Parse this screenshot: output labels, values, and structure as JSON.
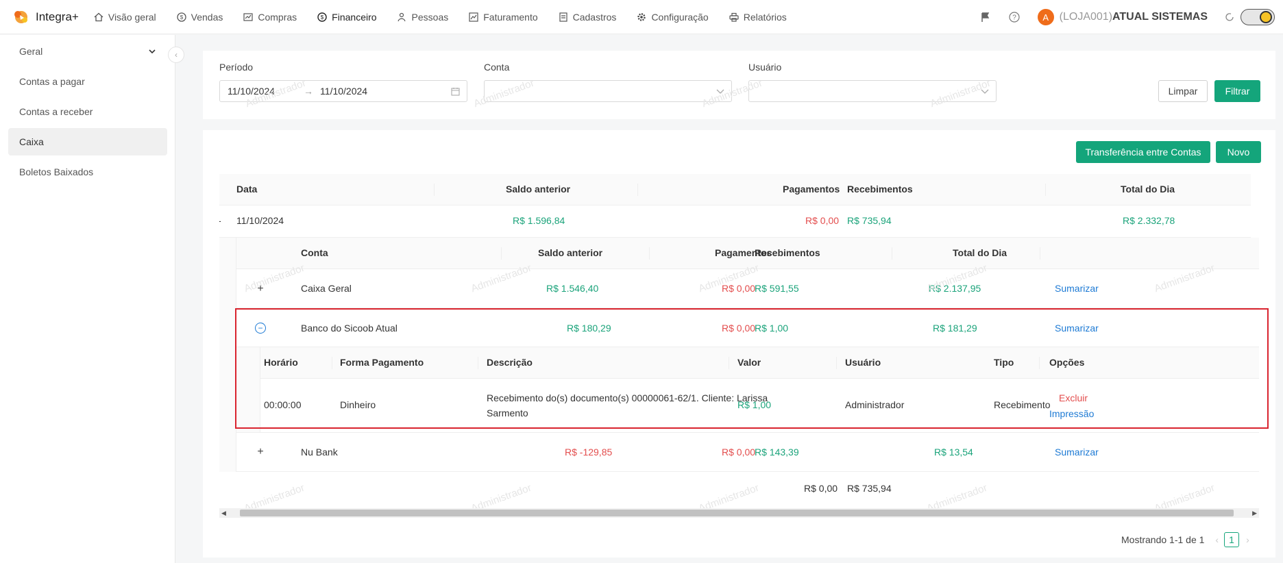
{
  "app": {
    "brand": "Integra+"
  },
  "nav": [
    {
      "label": "Visão geral",
      "icon": "home-icon"
    },
    {
      "label": "Vendas",
      "icon": "dollar-circle-icon"
    },
    {
      "label": "Compras",
      "icon": "chart-icon"
    },
    {
      "label": "Financeiro",
      "icon": "dollar-circle-icon"
    },
    {
      "label": "Pessoas",
      "icon": "people-icon"
    },
    {
      "label": "Faturamento",
      "icon": "trend-icon"
    },
    {
      "label": "Cadastros",
      "icon": "document-icon"
    },
    {
      "label": "Configuração",
      "icon": "gear-icon"
    },
    {
      "label": "Relatórios",
      "icon": "printer-icon"
    }
  ],
  "header": {
    "avatar_letter": "A",
    "store_code": "(LOJA001)",
    "store_name": "ATUAL SISTEMAS"
  },
  "sidebar": {
    "items": [
      {
        "label": "Geral"
      },
      {
        "label": "Contas a pagar"
      },
      {
        "label": "Contas a receber"
      },
      {
        "label": "Caixa"
      },
      {
        "label": "Boletos Baixados"
      }
    ]
  },
  "filters": {
    "periodo_label": "Período",
    "date_start": "11/10/2024",
    "date_end": "11/10/2024",
    "conta_label": "Conta",
    "usuario_label": "Usuário",
    "limpar": "Limpar",
    "filtrar": "Filtrar"
  },
  "actions": {
    "transfer": "Transferência entre Contas",
    "novo": "Novo"
  },
  "table": {
    "headers": {
      "data": "Data",
      "saldo": "Saldo anterior",
      "pagamentos": "Pagamentos",
      "recebimentos": "Recebimentos",
      "total": "Total do Dia"
    },
    "day": {
      "date": "11/10/2024",
      "saldo": "R$ 1.596,84",
      "pagamentos": "R$ 0,00",
      "recebimentos": "R$ 735,94",
      "total": "R$ 2.332,78"
    },
    "acc_headers": {
      "conta": "Conta",
      "saldo": "Saldo anterior",
      "pagamentos": "Pagamentos",
      "recebimentos": "Recebimentos",
      "total": "Total do Dia"
    },
    "accounts": [
      {
        "name": "Caixa Geral",
        "saldo": "R$ 1.546,40",
        "pagamentos": "R$ 0,00",
        "recebimentos": "R$ 591,55",
        "total": "R$ 2.137,95",
        "action": "Sumarizar"
      },
      {
        "name": "Banco do Sicoob Atual",
        "saldo": "R$ 180,29",
        "pagamentos": "R$ 0,00",
        "recebimentos": "R$ 1,00",
        "total": "R$ 181,29",
        "action": "Sumarizar"
      },
      {
        "name": "Nu Bank",
        "saldo": "R$ -129,85",
        "pagamentos": "R$ 0,00",
        "recebimentos": "R$ 143,39",
        "total": "R$ 13,54",
        "action": "Sumarizar"
      }
    ],
    "detail_headers": {
      "horario": "Horário",
      "forma": "Forma Pagamento",
      "descricao": "Descrição",
      "valor": "Valor",
      "usuario": "Usuário",
      "tipo": "Tipo",
      "opcoes": "Opções"
    },
    "detail": {
      "horario": "00:00:00",
      "forma": "Dinheiro",
      "descricao_l1": "Recebimento do(s) documento(s) 00000061-62/1. Cliente: Larissa",
      "descricao_l2": "Sarmento",
      "valor": "R$ 1,00",
      "usuario": "Administrador",
      "tipo": "Recebimento",
      "excluir": "Excluir",
      "impressao": "Impressão"
    },
    "totals": {
      "pagamentos": "R$ 0,00",
      "recebimentos": "R$ 735,94"
    }
  },
  "pagination": {
    "text": "Mostrando 1-1 de 1",
    "page": "1"
  },
  "watermark": "Administrador",
  "colors": {
    "accent": "#14a57b",
    "positive": "#1aa37a",
    "negative": "#e34d4d",
    "link": "#1d7ad4",
    "highlight": "#d9232e"
  }
}
